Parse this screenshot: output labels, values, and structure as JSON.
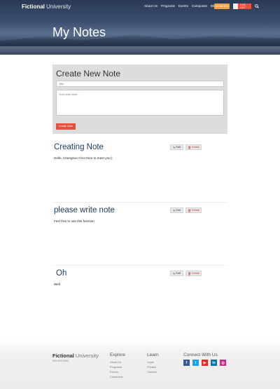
{
  "header": {
    "logo_bold": "Fictional",
    "logo_light": " University",
    "nav": [
      "About Us",
      "Programs",
      "Events",
      "Campuses",
      "Blog"
    ],
    "my_notes_button": "MY NOTES",
    "logout_button": "LOG OUT"
  },
  "hero": {
    "title": "My Notes"
  },
  "create_note": {
    "heading": "Create New Note",
    "title_placeholder": "Title",
    "body_placeholder": "Your note here...",
    "submit_label": "Create Note"
  },
  "notes": [
    {
      "title": "Creating Note",
      "body": "Hello, Changsoo Cho! Nice to meet you:)",
      "edit_label": "Edit",
      "delete_label": "Delete"
    },
    {
      "title": "please write note",
      "body": "Feel free to use this function",
      "edit_label": "Edit",
      "delete_label": "Delete"
    },
    {
      "title": "Oh",
      "body": "Well",
      "edit_label": "Edit",
      "delete_label": "Delete"
    }
  ],
  "footer": {
    "logo_bold": "Fictional",
    "logo_light": " University",
    "phone": "555.555.5555",
    "explore": {
      "heading": "Explore",
      "links": [
        "About Us",
        "Programs",
        "Events",
        "Campuses"
      ]
    },
    "learn": {
      "heading": "Learn",
      "links": [
        "Legal",
        "Privacy",
        "Careers"
      ]
    },
    "connect": {
      "heading": "Connect With Us",
      "icons": [
        "facebook-icon",
        "twitter-icon",
        "youtube-icon",
        "linkedin-icon",
        "instagram-icon"
      ]
    }
  },
  "colors": {
    "accent_orange": "#f5a042",
    "accent_red": "#e4503b",
    "note_title_blue": "#1a3a5c",
    "facebook": "#3b5998",
    "twitter": "#1da1f2",
    "youtube": "#e52d27",
    "linkedin": "#0077b5",
    "instagram": "#c13584"
  }
}
